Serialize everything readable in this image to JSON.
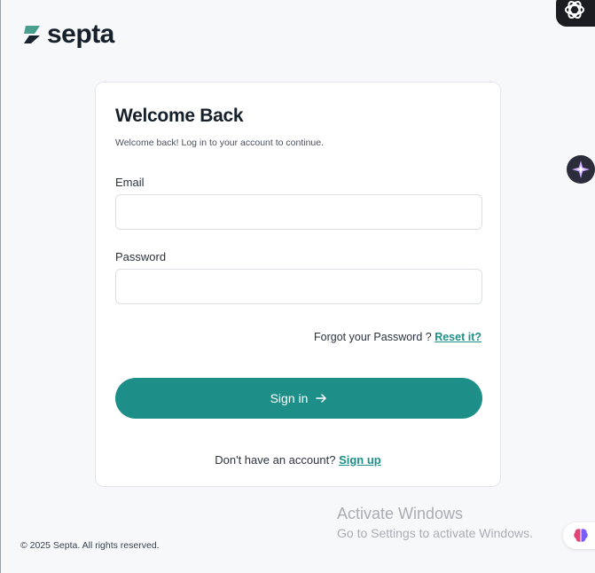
{
  "brand": {
    "name": "septa",
    "color": "#1e8f88"
  },
  "login": {
    "title": "Welcome Back",
    "subtitle": "Welcome back! Log in to your account to continue.",
    "email_label": "Email",
    "email_value": "",
    "password_label": "Password",
    "password_value": "",
    "forgot_text": "Forgot your Password ?",
    "reset_link": "Reset it?",
    "signin_label": "Sign in",
    "signup_text": "Don't have an account?",
    "signup_link": "Sign up"
  },
  "footer": {
    "copyright": "© 2025 Septa. All rights reserved."
  },
  "watermark": {
    "title": "Activate Windows",
    "subtitle": "Go to Settings to activate Windows."
  },
  "extensions": {
    "top": "chatgpt-icon",
    "side": "sparkle-icon",
    "bottom": "brain-icon"
  }
}
